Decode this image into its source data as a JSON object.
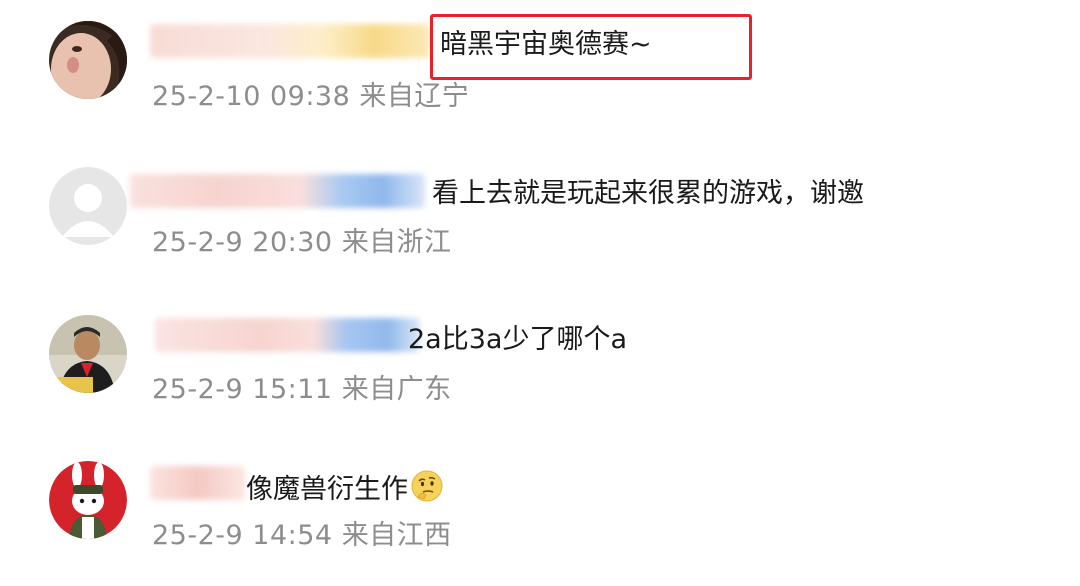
{
  "comments": [
    {
      "text": "暗黑宇宙奥德赛~",
      "timestamp": "25-2-10 09:38",
      "location": "来自辽宁"
    },
    {
      "text": "看上去就是玩起来很累的游戏，谢邀",
      "timestamp": "25-2-9 20:30",
      "location": "来自浙江"
    },
    {
      "text": "2a比3a少了哪个a",
      "timestamp": "25-2-9 15:11",
      "location": "来自广东"
    },
    {
      "text": "像魔兽衍生作",
      "timestamp": "25-2-9 14:54",
      "location": "来自江西",
      "emoji": "thinking-face-emoji"
    }
  ],
  "highlight": {
    "color": "#e8222a",
    "target": "comments.0.text"
  },
  "colors": {
    "text": "#1a1a1a",
    "meta": "#8d8d8d"
  },
  "icons": [
    "default-avatar-icon",
    "thinking-face-emoji"
  ]
}
